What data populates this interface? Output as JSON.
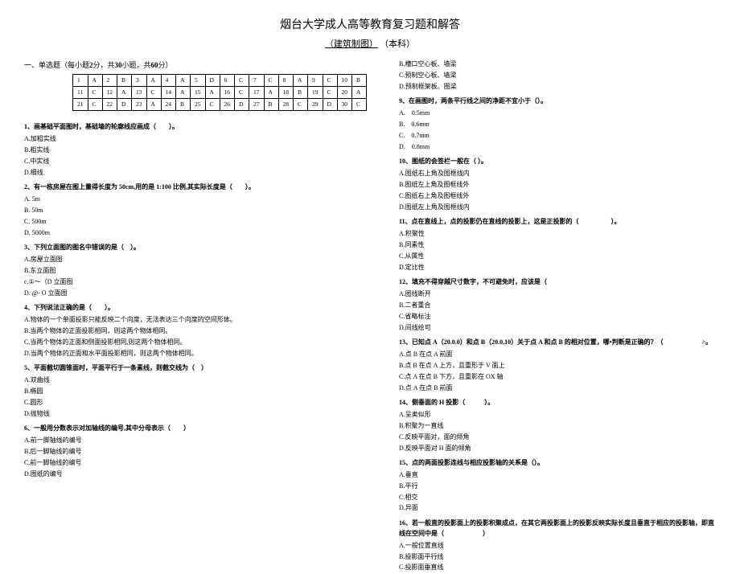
{
  "header": {
    "title": "烟台大学成人高等教育复习题和解答",
    "subtitle": "（建筑制图）",
    "subtitle_suffix": "（本科）"
  },
  "section1": {
    "title_prefix": "一、单选题（每小题",
    "title_score": "2",
    "title_mid": "分，共",
    "title_count": "30",
    "title_mid2": "小题，共",
    "title_total": "60",
    "title_suffix": "分）"
  },
  "answer_table": {
    "row1": [
      "1",
      "A",
      "2",
      "B",
      "3",
      "A",
      "4",
      "A",
      "5",
      "D",
      "6",
      "C",
      "7",
      "C",
      "8",
      "A",
      "9",
      "C",
      "10",
      "B"
    ],
    "row2": [
      "11",
      "C",
      "12",
      "A",
      "13",
      "C",
      "14",
      "A",
      "15",
      "A",
      "16",
      "C",
      "17",
      "A",
      "18",
      "B",
      "19",
      "C",
      "20",
      "A"
    ],
    "row3": [
      "21",
      "C",
      "22",
      "D",
      "23",
      "A",
      "24",
      "B",
      "25",
      "C",
      "26",
      "D",
      "27",
      "B",
      "28",
      "C",
      "29",
      "D",
      "30",
      "C"
    ]
  },
  "left_questions": [
    {
      "stem": "1、画基础平面图时，基础墙的轮廓线应画成（　　）。",
      "opts": [
        "A.加粗实线",
        "B.粗实线",
        "C.中实线",
        "D.细线"
      ]
    },
    {
      "stem": "2、有一栋房屋在图上量得长度为 50cm,用的是 1:100 比例,其实际长度是（　　）。",
      "opts": [
        "A. 5m",
        "B. 50m",
        "C. 500m",
        "D. 5000m"
      ]
    },
    {
      "stem": "3、下列立面图的图名中错误的是（　）。",
      "opts": [
        "A.房屋立面图",
        "B.东立面图",
        "c.①～（D 立面图",
        "D. @- O 立面图"
      ]
    },
    {
      "stem": "4、下列说法正确的是（　　）。",
      "opts": [
        "A.物体的一个单面投影只能反映二个向度，无法表达三个向度的空间形体。",
        "B.当两个物体的正面投影相同，则这两个物体相同。",
        "C.当两个物体的正面和侧面投影相同,则这两个物体相同。",
        "D.当两个物体的正面和水平面投影相同，则这两个物体相同。"
      ]
    },
    {
      "stem": "5、平面截切圆锥面时，平面平行于一条素线，则截交线为（　）",
      "opts": [
        "A.双曲线",
        "B.椭圆",
        "C.圆形",
        "D.抛物线"
      ]
    },
    {
      "stem": "6、一般用分数表示对加轴线的编号,其中分母表示（　　）",
      "opts": [
        "A.前一脚轴线的编号",
        "B.后一脚轴线的编号",
        "C.前一脚轴线的编号",
        "D.图纸的编号"
      ]
    }
  ],
  "right_questions": [
    {
      "stem": "",
      "opts": [
        "B.槽口空心板、墙梁",
        "C.预制空心板、墙梁",
        "D.预制框架板、圈梁"
      ]
    },
    {
      "stem": "9、在画图时，两条平行线之间的净距不宜小于（）。",
      "opts": [
        "A.　0.5mm",
        "B.　0.6mm",
        "C.　0.7mm",
        "D.　0.8mm"
      ]
    },
    {
      "stem": "10、图纸的会签栏一般在（ ）。",
      "opts": [
        "A.图纸右上角及图框线内",
        "B.图纸左上角及图框线外",
        "C.图纸右上角及图框线外",
        "D.图纸左上角及图框线内"
      ]
    },
    {
      "stem": "11、点在直线上，点的投影仍在直线的投影上，这是正投影的（　　　　　）。",
      "opts": [
        "A.积聚性",
        "B.同素性",
        "C.从属性",
        "D.定比性"
      ]
    },
    {
      "stem": "12、填充不得穿越尺寸数字，不可避免时，应该是（",
      "opts": [
        "A.图线断开",
        "B.二者重合",
        "C.省略标注",
        "D.间线绘可"
      ]
    },
    {
      "stem": "13、已知点 A（20.0.0）和点 B（20.0,10）关于点 A 和点 B 的相对位置，哪•判断是正确的？（　　　　　　>。",
      "opts": [
        "A.点 B 在点 A 前面",
        "B.点 B 在点 A 上方，且重形于 V 面上",
        "C.点 A 在点 B 下方，且重影在 OX 轴",
        "D.点 A 在点 B 前面"
      ]
    },
    {
      "stem": "14、侧垂面的 H 投影（　　　）。",
      "opts": [
        "A.呈类似形",
        "B.积聚为一直线",
        "C.反映平面对，面的倾角",
        "D.反映平面对 H 面的倾角"
      ]
    },
    {
      "stem": "15、点的两面投影连线与相应投影轴的关系是（）。",
      "opts": [
        "A.垂直",
        "B.平行",
        "C.相交",
        "D.异面"
      ]
    },
    {
      "stem": "16、若一般直的投影面上的投影积聚成点，在其它两投影面上的投影反映实际长度且垂直于相应的投影轴，即直线在空间中是（　　　　　　）",
      "opts": [
        "A.一般位置直线",
        "B.投影面平行线",
        "C.投影面垂直线"
      ]
    }
  ]
}
